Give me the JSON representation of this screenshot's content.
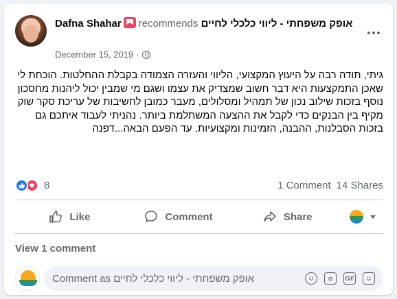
{
  "post": {
    "author": "Dafna Shahar",
    "recommends_text": "recommends",
    "page_name": "אופק משפחתי - ליווי כלכלי לחיים",
    "date": "December 15, 2019",
    "date_separator": "·",
    "body": "גיתי, תודה רבה על היעוץ המקצועי, הליווי והעזרה הצמודה בקבלת ההחלטות. הוכחת לי שאכן התמקצעות היא דבר חשוב שמצדיק את עצמו ושגם מי שמבין יכול ליהנות מחסכון נוסף בזכות שילוב נכון של תמהיל ומסלולים, מעבר כמובן לחשיבות של עריכת סקר שוק מקיף בין הבנקים כדי לקבל את ההצעה המשתלמת ביותר. נהניתי לעבוד איתכם גם בזכות הסבלנות, ההבנה, הזמינות ומקצועיות. עד הפעם הבאה...דפנה"
  },
  "reactions": {
    "count": "8",
    "comments_label": "1 Comment",
    "shares_label": "14 Shares"
  },
  "actions": {
    "like": "Like",
    "comment": "Comment",
    "share": "Share"
  },
  "comments": {
    "view_label": "View 1 comment",
    "placeholder": "Comment as אופק משפחתי - ליווי כלכלי לחיים",
    "gif_label": "GIF"
  },
  "colors": {
    "like_blue": "#1877f2",
    "love_red": "#f33e58",
    "secondary_text": "#65676b",
    "recommend_badge": "#f3425f"
  },
  "icons": [
    "more-options-icon",
    "globe-icon",
    "like-reaction-icon",
    "love-reaction-icon",
    "thumbs-up-icon",
    "comment-bubble-icon",
    "share-arrow-icon",
    "page-avatar-icon",
    "emoji-icon",
    "camera-icon",
    "gif-icon",
    "sticker-icon"
  ]
}
